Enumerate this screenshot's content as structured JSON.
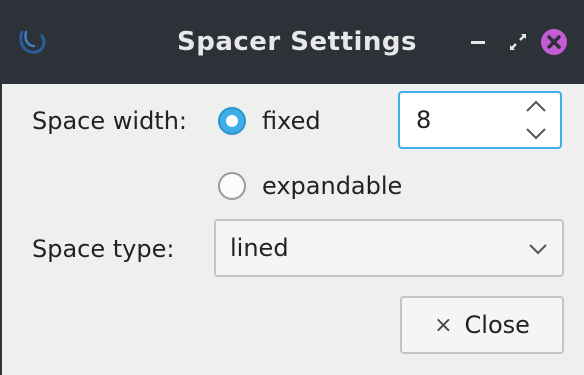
{
  "window": {
    "title": "Spacer Settings",
    "app_icon": "app-swirl-icon",
    "title_bar_color": "#2c3238",
    "close_icon_color": "#c65cd5"
  },
  "form": {
    "space_width_label": "Space width:",
    "fixed_label": "fixed",
    "fixed_checked": true,
    "expandable_label": "expandable",
    "expandable_checked": false,
    "width_value": "8",
    "space_type_label": "Space type:",
    "space_type_value": "lined"
  },
  "buttons": {
    "close_icon": "×",
    "close_label": "Close"
  },
  "colors": {
    "accent": "#3daee9",
    "background": "#efefef"
  }
}
